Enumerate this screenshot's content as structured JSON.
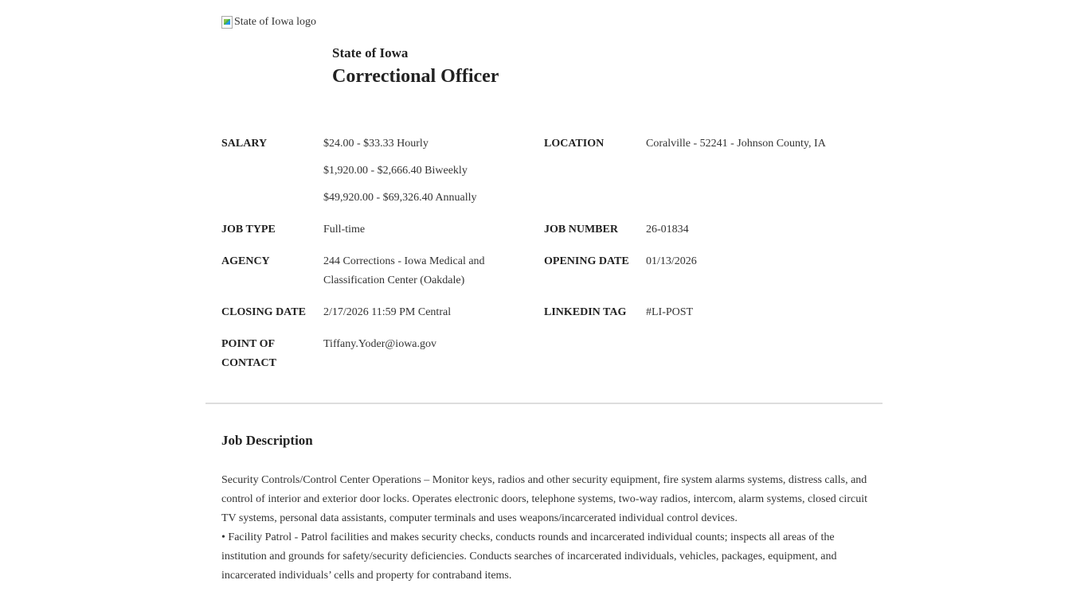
{
  "logo_alt": "State of Iowa logo",
  "employer": "State of Iowa",
  "job_title": "Correctional Officer",
  "labels": {
    "salary": "SALARY",
    "location": "LOCATION",
    "job_type": "JOB TYPE",
    "job_number": "JOB NUMBER",
    "agency": "AGENCY",
    "opening_date": "OPENING DATE",
    "closing_date": "CLOSING DATE",
    "linkedin_tag": "LINKEDIN TAG",
    "point_of_contact_1": "POINT OF",
    "point_of_contact_2": "CONTACT"
  },
  "values": {
    "salary": [
      "$24.00 - $33.33 Hourly",
      "$1,920.00 - $2,666.40 Biweekly",
      "$49,920.00 - $69,326.40 Annually"
    ],
    "location": "Coralville - 52241 - Johnson County, IA",
    "job_type": "Full-time",
    "job_number": "26-01834",
    "agency_line1": "244 Corrections - Iowa Medical and",
    "agency_line2": "Classification Center (Oakdale)",
    "opening_date": "01/13/2026",
    "closing_date": "2/17/2026 11:59 PM Central",
    "linkedin_tag": "#LI-POST",
    "point_of_contact": "Tiffany.Yoder@iowa.gov"
  },
  "job_description": {
    "heading": "Job Description",
    "paragraphs": [
      "Security Controls/Control Center Operations – Monitor keys, radios and other security equipment, fire system alarms systems, distress calls, and control of interior and exterior door locks. Operates electronic doors, telephone systems, two-way radios, intercom, alarm systems, closed circuit TV systems, personal data assistants, computer terminals and uses weapons/incarcerated individual control devices.",
      "• Facility Patrol - Patrol facilities and makes security checks, conducts rounds and incarcerated individual counts; inspects all areas of the institution and grounds for safety/security deficiencies. Conducts searches of incarcerated individuals, vehicles, packages, equipment, and incarcerated individuals’ cells and property for contraband items."
    ]
  }
}
